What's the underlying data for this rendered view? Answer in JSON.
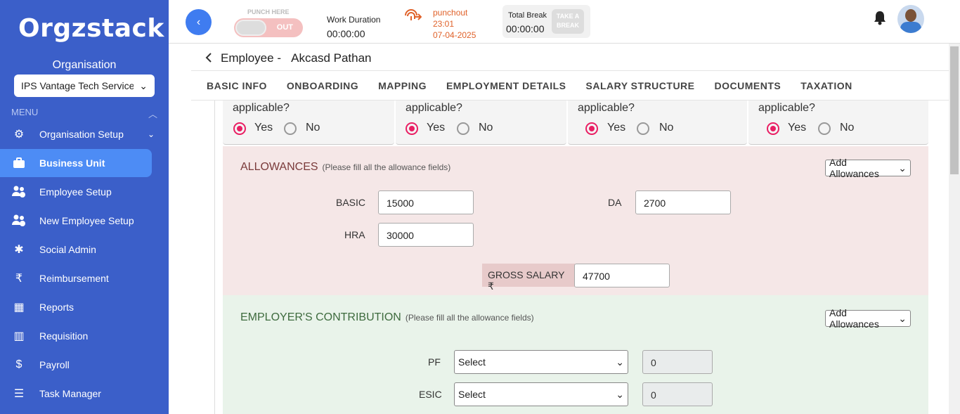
{
  "sidebar": {
    "logo": "Orgzstack",
    "org_label": "Organisation",
    "org_select_value": "IPS Vantage Tech Services",
    "menu_header": "MENU",
    "items": [
      {
        "label": "Organisation Setup",
        "icon": "org-setup-icon",
        "glyph": "⚙"
      },
      {
        "label": "Business Unit",
        "icon": "briefcase-icon",
        "glyph": "💼"
      },
      {
        "label": "Employee Setup",
        "icon": "users-gear-icon",
        "glyph": "👥"
      },
      {
        "label": "New Employee Setup",
        "icon": "users-gear-icon",
        "glyph": "👥"
      },
      {
        "label": "Social Admin",
        "icon": "social-icon",
        "glyph": "✱"
      },
      {
        "label": "Reimbursement",
        "icon": "reimbursement-icon",
        "glyph": "₹"
      },
      {
        "label": "Reports",
        "icon": "calendar-grid-icon",
        "glyph": "▦"
      },
      {
        "label": "Requisition",
        "icon": "requisition-icon",
        "glyph": "▥"
      },
      {
        "label": "Payroll",
        "icon": "payroll-icon",
        "glyph": "$"
      },
      {
        "label": "Task Manager",
        "icon": "task-list-icon",
        "glyph": "☰"
      }
    ]
  },
  "topbar": {
    "punch_label": "PUNCH HERE",
    "punch_state": "OUT",
    "work_label": "Work Duration",
    "work_value": "00:00:00",
    "punchout_label": "punchout",
    "punchout_time": "23:01",
    "punchout_date": "07-04-2025",
    "break_label": "Total Break",
    "break_value": "00:00:00",
    "take_break_line1": "TAKE A",
    "take_break_line2": "BREAK"
  },
  "employee": {
    "prefix": "Employee -",
    "name": "Akcasd Pathan"
  },
  "tabs": [
    "BASIC INFO",
    "ONBOARDING",
    "MAPPING",
    "EMPLOYMENT DETAILS",
    "SALARY STRUCTURE",
    "DOCUMENTS",
    "TAXATION"
  ],
  "radio_cards": [
    {
      "question": "applicable?",
      "yes": "Yes",
      "no": "No"
    },
    {
      "question": "applicable?",
      "yes": "Yes",
      "no": "No"
    },
    {
      "question": "applicable?",
      "yes": "Yes",
      "no": "No"
    },
    {
      "question": "applicable?",
      "yes": "Yes",
      "no": "No"
    }
  ],
  "allowances": {
    "title": "ALLOWANCES",
    "note": "(Please fill all the allowance fields)",
    "add_label": "Add Allowances",
    "basic_label": "BASIC",
    "basic_value": "15000",
    "da_label": "DA",
    "da_value": "2700",
    "hra_label": "HRA",
    "hra_value": "30000",
    "gross_label": "GROSS SALARY ₹",
    "gross_value": "47700"
  },
  "employer": {
    "title": "EMPLOYER'S CONTRIBUTION",
    "note": "(Please fill all the allowance fields)",
    "add_label": "Add Allowances",
    "pf_label": "PF",
    "pf_select": "Select",
    "pf_value": "0",
    "esic_label": "ESIC",
    "esic_select": "Select",
    "esic_value": "0"
  },
  "colors": {
    "sidebar": "#3b5fc9",
    "active_item": "#4d8cf5",
    "radio_selected": "#e91e63",
    "allowance_bg": "#f5e7e7",
    "employer_bg": "#e9f3ea",
    "punchout": "#e0622a"
  }
}
